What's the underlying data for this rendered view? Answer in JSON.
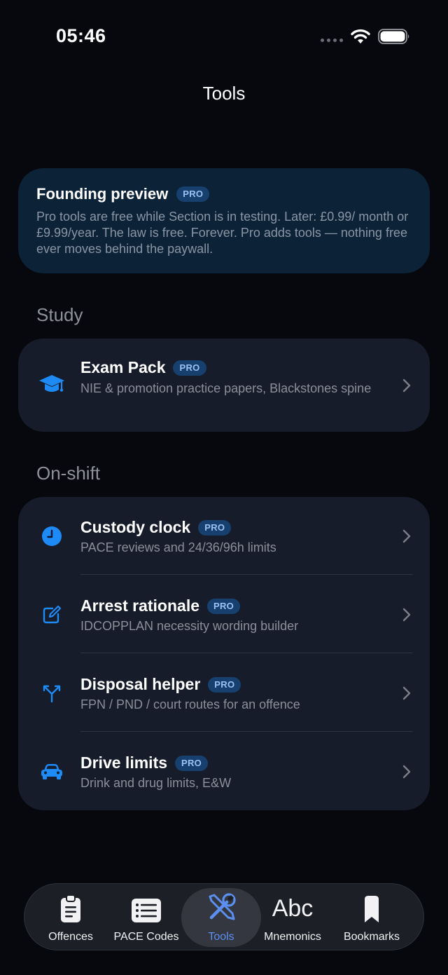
{
  "status": {
    "time": "05:46"
  },
  "nav": {
    "title": "Tools"
  },
  "colors": {
    "accent": "#1e8af5",
    "pro_badge_bg": "#18406e",
    "active_tab": "#5b8ff0"
  },
  "preview": {
    "title": "Founding preview",
    "badge": "PRO",
    "body": "Pro tools are free while Section is in testing. Later: £0.99/ month or £9.99/year. The law is free. Forever. Pro adds tools — nothing free ever moves behind the paywall."
  },
  "sections": [
    {
      "header": "Study",
      "items": [
        {
          "icon": "graduation-cap-icon",
          "title": "Exam Pack",
          "badge": "PRO",
          "subtitle": "NIE & promotion practice papers, Blackstones spine"
        }
      ]
    },
    {
      "header": "On-shift",
      "items": [
        {
          "icon": "clock-icon",
          "title": "Custody clock",
          "badge": "PRO",
          "subtitle": "PACE reviews and 24/36/96h limits"
        },
        {
          "icon": "edit-square-icon",
          "title": "Arrest rationale",
          "badge": "PRO",
          "subtitle": "IDCOPPLAN necessity wording builder"
        },
        {
          "icon": "branch-arrows-icon",
          "title": "Disposal helper",
          "badge": "PRO",
          "subtitle": "FPN / PND / court routes for an offence"
        },
        {
          "icon": "car-icon",
          "title": "Drive limits",
          "badge": "PRO",
          "subtitle": "Drink and drug limits, E&W"
        }
      ]
    }
  ],
  "tabs": [
    {
      "icon": "clipboard-icon",
      "label": "Offences"
    },
    {
      "icon": "list-icon",
      "label": "PACE Codes"
    },
    {
      "icon": "tools-icon",
      "label": "Tools",
      "active": true
    },
    {
      "icon": "abc-text-icon",
      "glyph": "Abc",
      "label": "Mnemonics"
    },
    {
      "icon": "bookmark-icon",
      "label": "Bookmarks"
    }
  ]
}
